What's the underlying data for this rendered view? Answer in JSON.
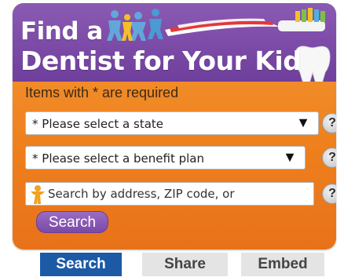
{
  "widget": {
    "title_line1": "Find a",
    "title_line2": "Dentist for Your Kid",
    "required_note": "Items with * are required",
    "state_select": {
      "selected": "* Please select a state"
    },
    "plan_select": {
      "selected": "* Please select a benefit plan"
    },
    "search_input": {
      "placeholder": "Search by address, ZIP code, or"
    },
    "help_label": "?",
    "search_button": "Search"
  },
  "tabs": [
    {
      "label": "Search",
      "active": true
    },
    {
      "label": "Share",
      "active": false
    },
    {
      "label": "Embed",
      "active": false
    }
  ],
  "colors": {
    "header_purple": "#7c4aa7",
    "body_orange": "#ee7f1c",
    "active_tab": "#1c5aa6",
    "inactive_tab": "#e4e4e4"
  },
  "icons": [
    "kids-silhouettes-icon",
    "toothbrush-icon",
    "tooth-icon",
    "child-figure-icon",
    "help-icon",
    "dropdown-arrow-icon"
  ]
}
